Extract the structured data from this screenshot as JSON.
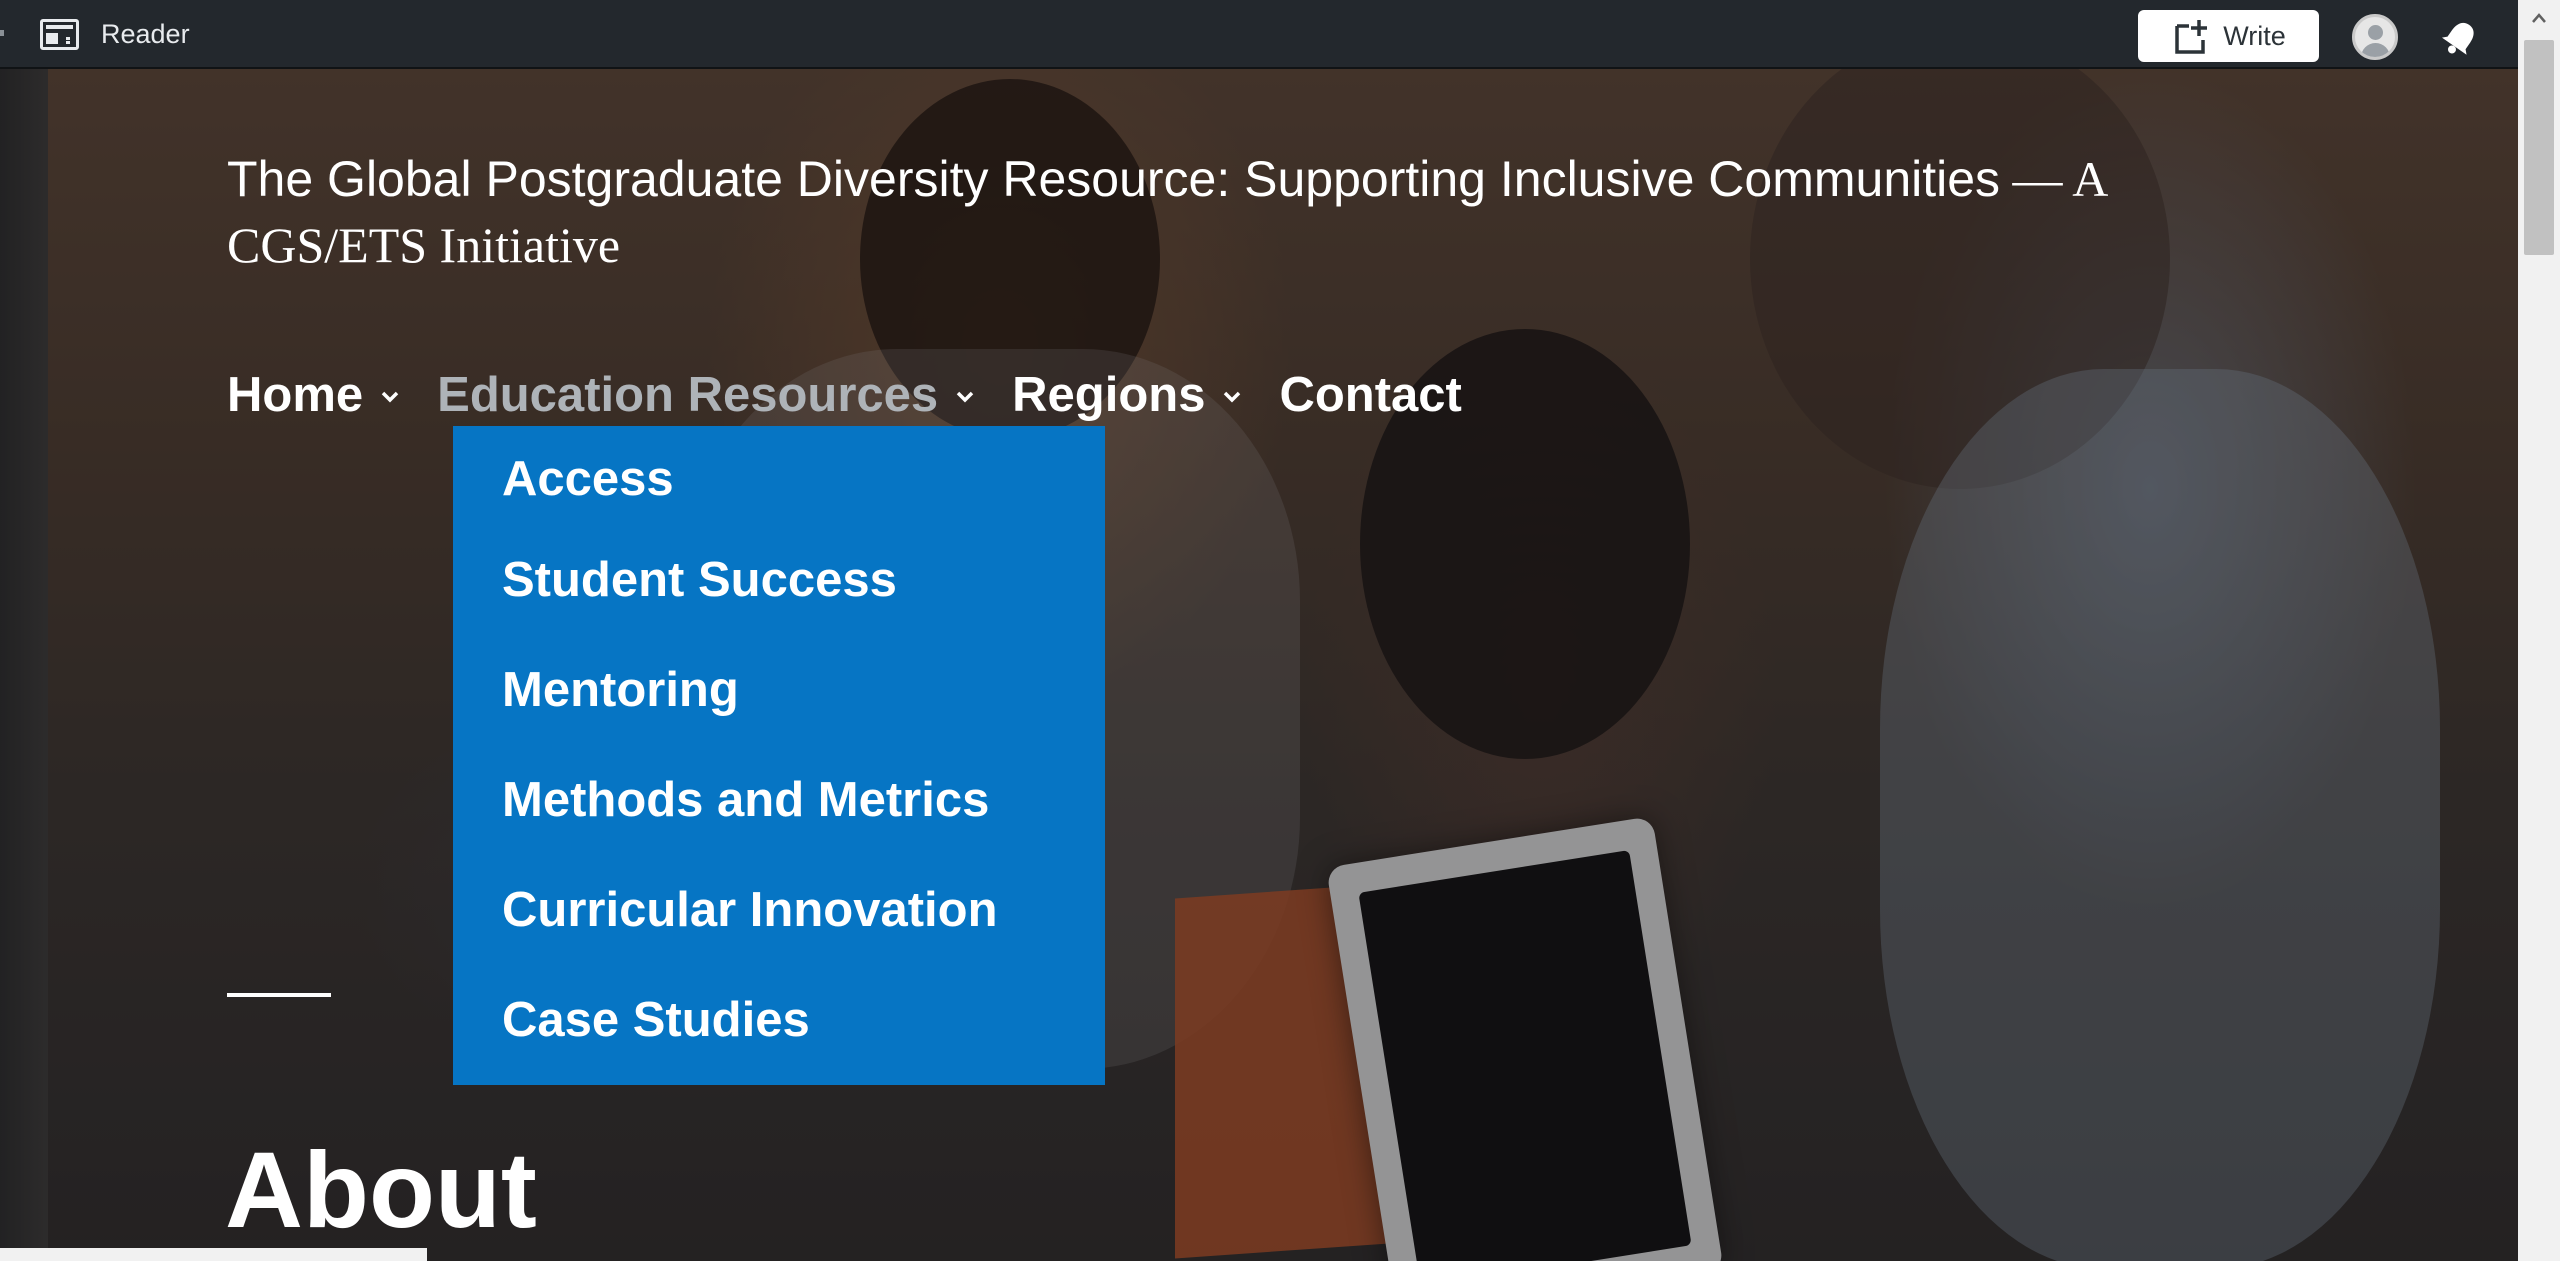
{
  "topbar": {
    "reader_label": "Reader",
    "write_label": "Write",
    "icons": {
      "reader": "reader-icon",
      "write": "write-plus-icon",
      "avatar": "user-avatar-icon",
      "notifications": "bell-icon"
    }
  },
  "site": {
    "title_main": "The Global Postgraduate Diversity Resource: Supporting Inclusive Communities",
    "title_suffix": " — A CGS/ETS Initiative"
  },
  "nav": {
    "items": [
      {
        "label": "Home",
        "has_dropdown": true
      },
      {
        "label": "Education Resources",
        "has_dropdown": true,
        "active": true
      },
      {
        "label": "Regions",
        "has_dropdown": true
      },
      {
        "label": "Contact",
        "has_dropdown": false
      }
    ]
  },
  "dropdown": {
    "items": [
      {
        "label": "Access"
      },
      {
        "label": "Student Success"
      },
      {
        "label": "Mentoring"
      },
      {
        "label": "Methods and Metrics"
      },
      {
        "label": "Curricular Innovation"
      },
      {
        "label": "Case Studies"
      }
    ]
  },
  "about": {
    "heading": "About"
  },
  "colors": {
    "topbar_bg": "#23282d",
    "dropdown_bg": "#0675c4",
    "nav_active": "#aeb3b8"
  }
}
